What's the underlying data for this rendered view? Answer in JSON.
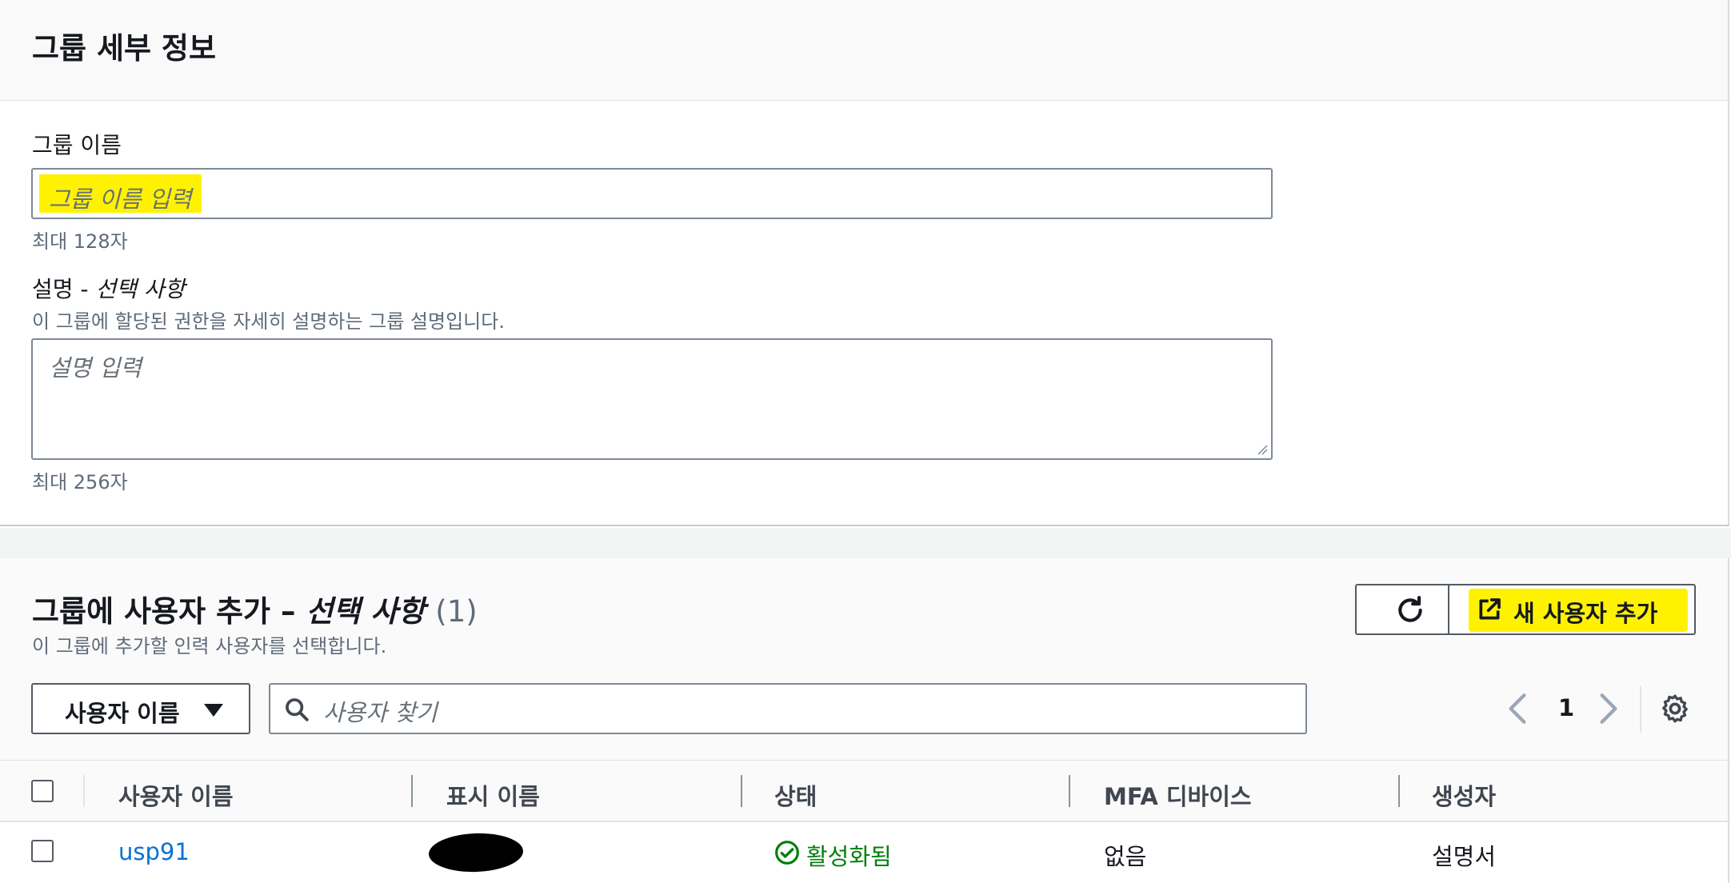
{
  "details": {
    "title": "그룹 세부 정보",
    "group_name_label": "그룹 이름",
    "group_name_placeholder": "그룹 이름 입력",
    "group_name_hint": "최대 128자",
    "description_label": "설명 - ",
    "description_optional": "선택 사항",
    "description_help": "이 그룹에 할당된 권한을 자세히 설명하는 그룹 설명입니다.",
    "description_placeholder": "설명 입력",
    "description_hint": "최대 256자"
  },
  "users": {
    "title": "그룹에 사용자 추가 – ",
    "title_optional": "선택 사항",
    "count": "(1)",
    "description": "이 그룹에 추가할 인력 사용자를 선택합니다.",
    "refresh_icon": "refresh-icon",
    "add_user_label": "새 사용자 추가",
    "add_user_icon": "external-link-icon",
    "filter_label": "사용자 이름",
    "search_placeholder": "사용자 찾기",
    "page": "1",
    "highlight_color": "#fff200",
    "link_color": "#0972d3",
    "status_color": "#037f0c"
  },
  "table": {
    "columns": [
      "사용자 이름",
      "표시 이름",
      "상태",
      "MFA 디바이스",
      "생성자"
    ],
    "rows": [
      {
        "username": "usp91",
        "display_name": "",
        "status": "활성화됨",
        "mfa": "없음",
        "created_by": "설명서"
      }
    ]
  }
}
